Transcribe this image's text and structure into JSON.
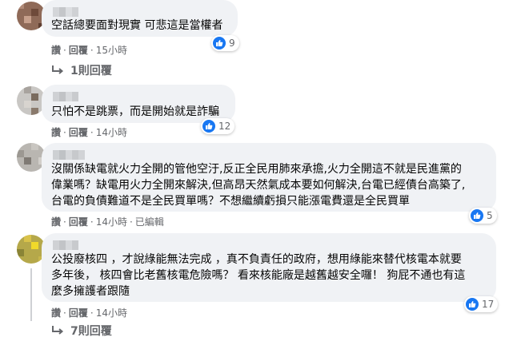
{
  "comments": [
    {
      "text_lines": [
        "空話總要面對現實 可悲這是當權者"
      ],
      "actions": {
        "like": "讚",
        "reply": "回覆",
        "time": "15小時"
      },
      "reactions": "9",
      "replies_label": "1則回覆"
    },
    {
      "text_lines": [
        "只怕不是跳票，而是開始就是詐騙"
      ],
      "actions": {
        "like": "讚",
        "reply": "回覆",
        "time": "14小時"
      },
      "reactions": "12"
    },
    {
      "text_lines": [
        "沒關係缺電就火力全開的管他空汙,反正全民用肺來承擔,火力全開這不就是民進黨的",
        "偉業嗎？缺電用火力全開來解決,但高昂天然氣成本要如何解決,台電已經債台高築了,",
        "台電的負債難道不是全民買單嗎？不想繼續虧損只能漲電費還是全民買單"
      ],
      "actions": {
        "like": "讚",
        "reply": "回覆",
        "time": "14小時",
        "edited": "已編輯"
      },
      "reactions": "5"
    },
    {
      "text_lines": [
        "公投廢核四 ，才說綠能無法完成 ，真不負責任的政府，想用綠能來替代核電本就要",
        "多年後， 核四會比老舊核電危險嗎？ 看來核能廠是越舊越安全囉！ 狗屁不通也有這",
        "麼多擁護者跟隨"
      ],
      "actions": {
        "like": "讚",
        "reply": "回覆",
        "time": "14小時"
      },
      "reactions": "17",
      "replies_label": "7則回覆"
    }
  ]
}
